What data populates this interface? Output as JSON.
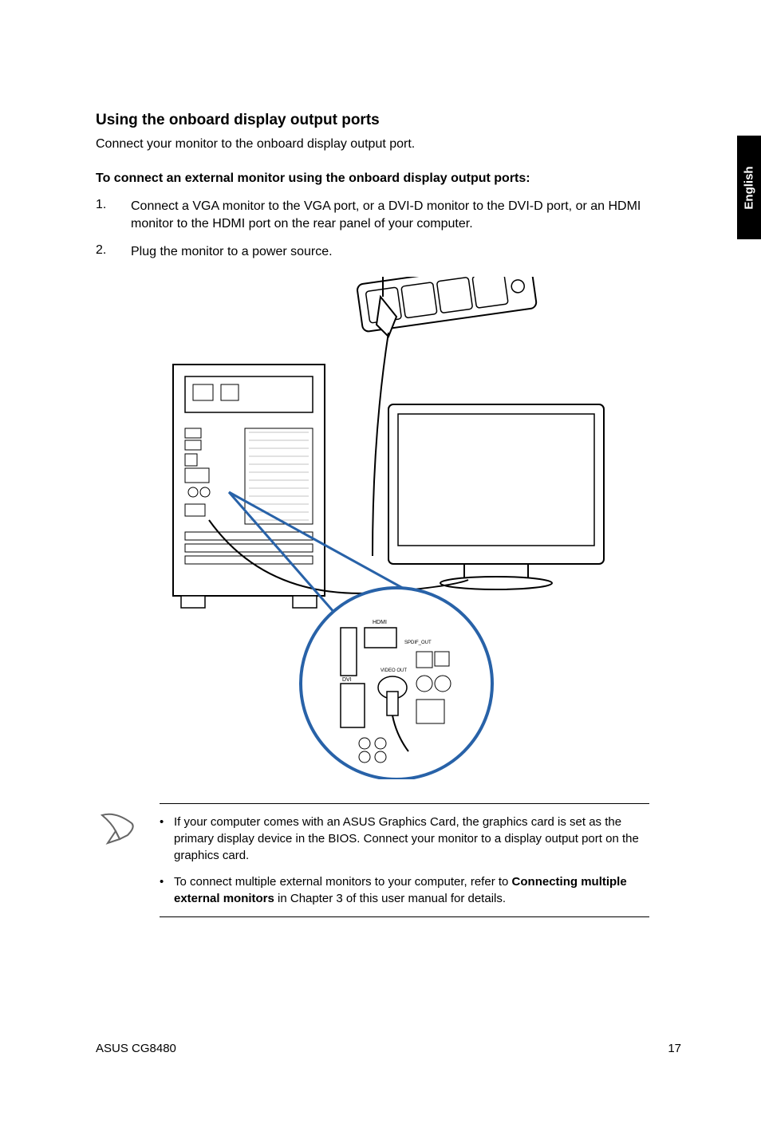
{
  "sideTab": "English",
  "sectionTitle": "Using the onboard display output ports",
  "introText": "Connect your monitor to the onboard display output port.",
  "subsectionTitle": "To connect an external monitor using the onboard display output ports:",
  "steps": [
    {
      "num": "1.",
      "text": "Connect a VGA monitor to the VGA port, or a DVI-D monitor to the DVI-D port, or an HDMI monitor to the HDMI port on the rear panel of your computer."
    },
    {
      "num": "2.",
      "text": "Plug the monitor to a power source."
    }
  ],
  "diagramLabels": {
    "hdmi": "HDMI",
    "dvi": "DVI",
    "spdifOut": "SPDIF_OUT",
    "videoOut": "VIDEO OUT"
  },
  "notes": [
    {
      "prefix": "If your computer comes with an ASUS Graphics Card, the graphics card is set as the primary display device in the BIOS. Connect your monitor to a display output port on the graphics card.",
      "bold": "",
      "suffix": ""
    },
    {
      "prefix": "To connect multiple external monitors to your computer, refer to ",
      "bold": "Connecting multiple external monitors",
      "suffix": " in Chapter 3 of this user manual for details."
    }
  ],
  "footer": {
    "left": "ASUS CG8480",
    "right": "17"
  }
}
